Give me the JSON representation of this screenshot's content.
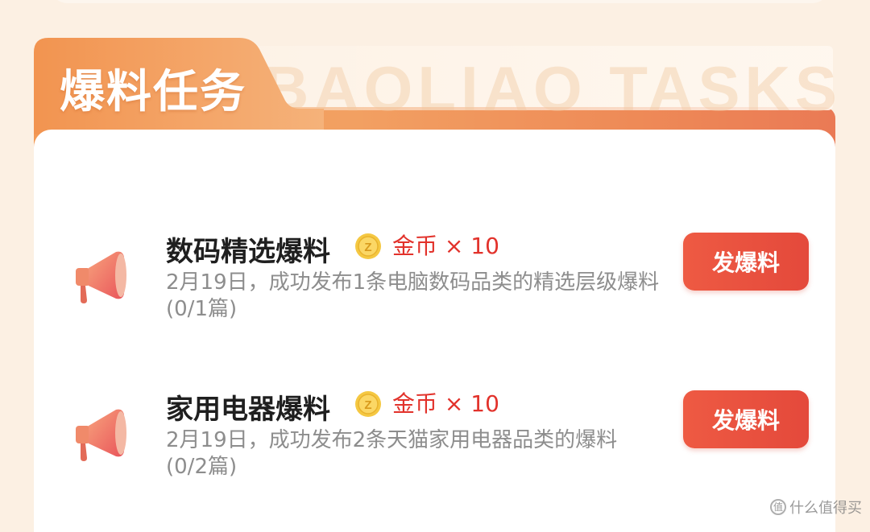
{
  "section": {
    "title": "爆料任务",
    "watermark_text": "BAOLIAO TASKS"
  },
  "tasks": [
    {
      "title": "数码精选爆料",
      "reward_label": "金币",
      "reward_amount": "× 10",
      "description": "2月19日，成功发布1条电脑数码品类的精选层级爆料 (0/1篇)",
      "button_label": "发爆料"
    },
    {
      "title": "家用电器爆料",
      "reward_label": "金币",
      "reward_amount": "× 10",
      "description": "2月19日，成功发布2条天猫家用电器品类的爆料 (0/2篇)",
      "button_label": "发爆料"
    }
  ],
  "icons": {
    "task_icon": "megaphone-icon",
    "reward_icon": "gold-coin-icon"
  },
  "colors": {
    "accent_orange": "#f2a062",
    "button_red": "#e4493b",
    "reward_red": "#e2322b"
  },
  "brand_watermark": {
    "logo_char": "值",
    "text": "什么值得买"
  }
}
